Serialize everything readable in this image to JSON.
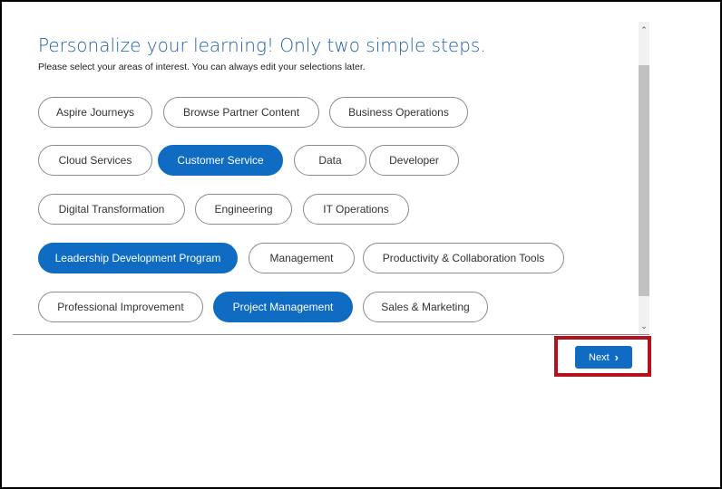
{
  "header": {
    "title": "Personalize your learning! Only two simple steps.",
    "subtitle": "Please select your areas of interest. You can always edit your selections later."
  },
  "topics": [
    {
      "label": "Aspire Journeys",
      "selected": false
    },
    {
      "label": "Browse Partner Content",
      "selected": false
    },
    {
      "label": "Business Operations",
      "selected": false
    },
    {
      "label": "Cloud Services",
      "selected": false
    },
    {
      "label": "Customer Service",
      "selected": true
    },
    {
      "label": "Data",
      "selected": false
    },
    {
      "label": "Developer",
      "selected": false
    },
    {
      "label": "Digital Transformation",
      "selected": false
    },
    {
      "label": "Engineering",
      "selected": false
    },
    {
      "label": "IT Operations",
      "selected": false
    },
    {
      "label": "Leadership Development Program",
      "selected": true
    },
    {
      "label": "Management",
      "selected": false
    },
    {
      "label": "Productivity & Collaboration Tools",
      "selected": false
    },
    {
      "label": "Professional Improvement",
      "selected": false
    },
    {
      "label": "Project Management",
      "selected": true
    },
    {
      "label": "Sales & Marketing",
      "selected": false
    }
  ],
  "footer": {
    "next_label": "Next",
    "next_icon": "chevron-right-icon"
  },
  "scrollbar": {
    "up_icon": "chevron-up-icon",
    "down_icon": "chevron-down-icon"
  },
  "colors": {
    "accent": "#0f6cc2",
    "title": "#1f5fa8",
    "highlight": "#b3121d"
  }
}
